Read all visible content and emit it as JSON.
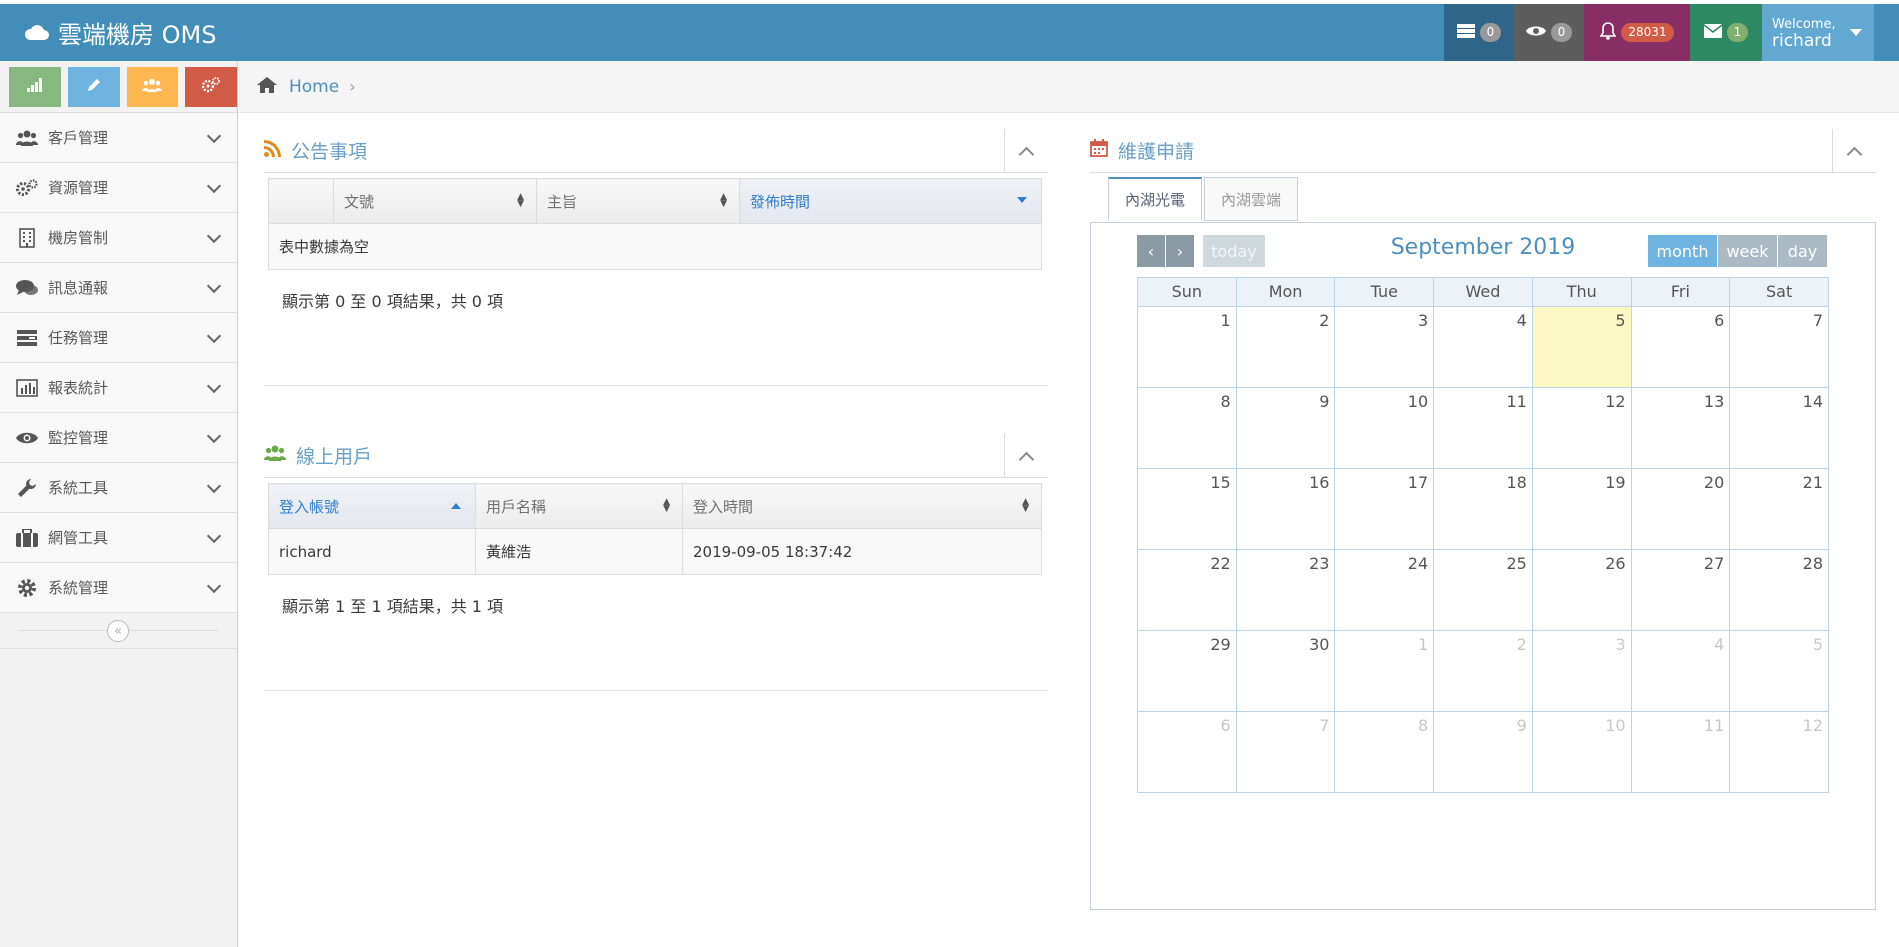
{
  "app": {
    "title": "雲端機房 OMS"
  },
  "navbar": {
    "tasks_count": "0",
    "watch_count": "0",
    "notifications_count": "28031",
    "messages_count": "1",
    "welcome": "Welcome,",
    "username": "richard"
  },
  "sidebar": {
    "shortcut_colors": [
      "#87b87f",
      "#6fb3e0",
      "#ffb752",
      "#d15b47"
    ],
    "items": [
      {
        "label": "客戶管理",
        "icon": "users-icon"
      },
      {
        "label": "資源管理",
        "icon": "cogs-icon"
      },
      {
        "label": "機房管制",
        "icon": "building-icon"
      },
      {
        "label": "訊息通報",
        "icon": "comments-icon"
      },
      {
        "label": "任務管理",
        "icon": "tasks-icon"
      },
      {
        "label": "報表統計",
        "icon": "bar-chart-icon"
      },
      {
        "label": "監控管理",
        "icon": "eye-icon"
      },
      {
        "label": "系統工具",
        "icon": "wrench-icon"
      },
      {
        "label": "網管工具",
        "icon": "briefcase-icon"
      },
      {
        "label": "系統管理",
        "icon": "gear-icon"
      }
    ]
  },
  "breadcrumb": {
    "home": "Home"
  },
  "announcements": {
    "title": "公告事項",
    "columns": [
      "",
      "文號",
      "主旨",
      "發佈時間"
    ],
    "empty_text": "表中數據為空",
    "info": "顯示第 0 至 0 項結果，共 0 項"
  },
  "online_users": {
    "title": "線上用戶",
    "columns": [
      "登入帳號",
      "用戶名稱",
      "登入時間"
    ],
    "rows": [
      [
        "richard",
        "黃維浩",
        "2019-09-05 18:37:42"
      ]
    ],
    "info": "顯示第 1 至 1 項結果，共 1 項"
  },
  "maintenance": {
    "title": "維護申請",
    "tabs": [
      "內湖光電",
      "內湖雲端"
    ],
    "active_tab": 0,
    "calendar": {
      "title": "September 2019",
      "today_label": "today",
      "views": [
        "month",
        "week",
        "day"
      ],
      "active_view": "month",
      "weekdays": [
        "Sun",
        "Mon",
        "Tue",
        "Wed",
        "Thu",
        "Fri",
        "Sat"
      ],
      "today_date": 5,
      "weeks": [
        [
          "1",
          "2",
          "3",
          "4",
          "5",
          "6",
          "7"
        ],
        [
          "8",
          "9",
          "10",
          "11",
          "12",
          "13",
          "14"
        ],
        [
          "15",
          "16",
          "17",
          "18",
          "19",
          "20",
          "21"
        ],
        [
          "22",
          "23",
          "24",
          "25",
          "26",
          "27",
          "28"
        ],
        [
          "29",
          "30",
          "1",
          "2",
          "3",
          "4",
          "5"
        ],
        [
          "6",
          "7",
          "8",
          "9",
          "10",
          "11",
          "12"
        ]
      ],
      "other_month_from_index": 30
    }
  }
}
